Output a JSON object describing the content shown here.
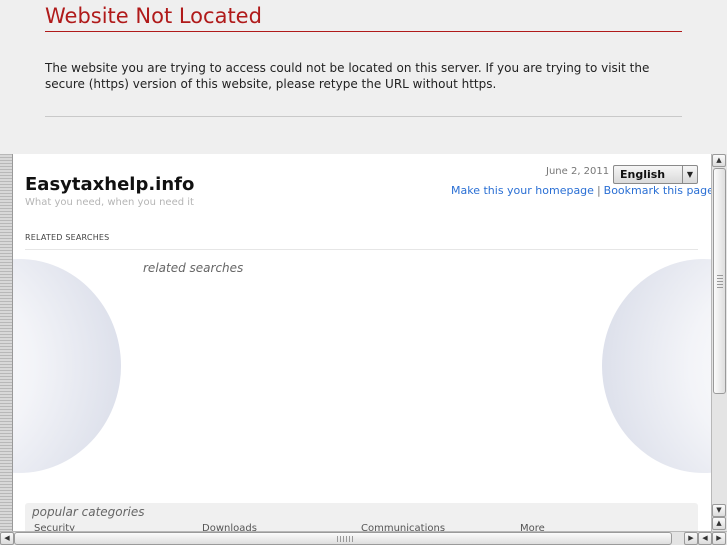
{
  "error": {
    "title": "Website Not Located",
    "message": "The website you are trying to access could not be located on this server. If you are trying to visit the secure (https) version of this website, please retype the URL without https."
  },
  "site": {
    "title": "Easytaxhelp.info",
    "tagline": "What you need, when you need it",
    "date": "June 2, 2011",
    "language": "English",
    "links": {
      "homepage": "Make this your homepage",
      "separator": "|",
      "bookmark": "Bookmark this page"
    },
    "related_label": "RELATED SEARCHES",
    "related_heading": "related searches",
    "popular": {
      "title": "popular categories",
      "items": [
        "Security",
        "Downloads",
        "Communications",
        "More"
      ]
    }
  },
  "icons": {
    "scroll_up": "arrow-up-icon",
    "scroll_down": "arrow-down-icon",
    "scroll_left": "arrow-left-icon",
    "scroll_right": "arrow-right-icon",
    "dropdown": "chevron-down-icon"
  },
  "colors": {
    "error_red": "#b01a1a",
    "link_blue": "#2a6fd4"
  }
}
